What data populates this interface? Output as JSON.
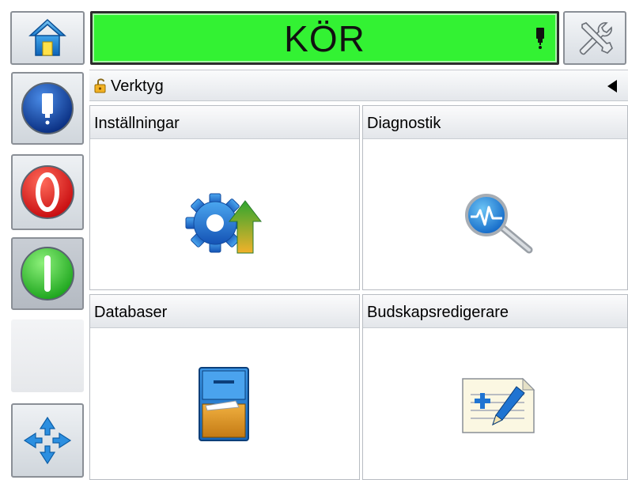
{
  "header": {
    "status": "KÖR",
    "status_color": "#33f233",
    "home_icon": "home-icon",
    "tools_icon": "tools-icon",
    "indicator_icon": "ink-cartridge-icon"
  },
  "sidebar": {
    "items": [
      {
        "icon": "printhead-icon",
        "state": "normal"
      },
      {
        "icon": "stop-icon",
        "color": "#e8262a"
      },
      {
        "icon": "start-icon",
        "color": "#3fd23f",
        "state": "active"
      },
      {
        "icon": "empty"
      },
      {
        "icon": "navigation-arrows-icon"
      }
    ]
  },
  "breadcrumb": {
    "label": "Verktyg",
    "lock_icon": "unlocked-padlock-icon"
  },
  "tiles": [
    {
      "label": "Inställningar",
      "icon": "settings-gear-upload-icon"
    },
    {
      "label": "Diagnostik",
      "icon": "diagnostics-magnifier-icon"
    },
    {
      "label": "Databaser",
      "icon": "database-cabinet-icon"
    },
    {
      "label": "Budskapsredigerare",
      "icon": "message-editor-icon"
    }
  ]
}
